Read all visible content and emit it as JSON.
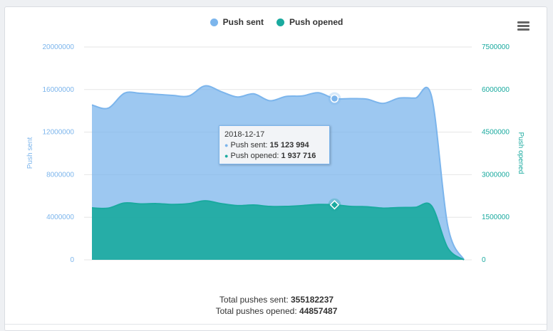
{
  "legend": {
    "items": [
      {
        "label": "Push sent",
        "color": "#7cb5ec"
      },
      {
        "label": "Push opened",
        "color": "#1aaa9f"
      }
    ]
  },
  "menu_icon": "hamburger-menu-icon",
  "axes": {
    "left": {
      "title": "Push sent",
      "ticks": [
        "20000000",
        "16000000",
        "12000000",
        "8000000",
        "4000000",
        "0"
      ],
      "color": "#7cb5ec"
    },
    "right": {
      "title": "Push opened",
      "ticks": [
        "7500000",
        "6000000",
        "4500000",
        "3000000",
        "1500000",
        "0"
      ],
      "color": "#1aaa9f"
    }
  },
  "tooltip": {
    "date": "2018-12-17",
    "rows": [
      {
        "label": "Push sent:",
        "value": "15 123 994"
      },
      {
        "label": "Push opened:",
        "value": "1 937 716"
      }
    ]
  },
  "totals": {
    "sent_label": "Total pushes sent:",
    "sent_value": "355182237",
    "opened_label": "Total pushes opened:",
    "opened_value": "44857487"
  },
  "chart_data": {
    "type": "area",
    "xlabel": "",
    "grid": true,
    "legend_position": "top-center",
    "series": [
      {
        "name": "Push sent",
        "axis": "left",
        "ylim": [
          0,
          20000000
        ],
        "color": "#7cb5ec",
        "values": [
          14550000,
          14250000,
          15650000,
          15650000,
          15550000,
          15450000,
          15400000,
          16350000,
          15800000,
          15300000,
          15600000,
          14950000,
          15350000,
          15400000,
          15700000,
          15150000,
          15150000,
          15100000,
          14700000,
          15200000,
          15200000,
          15350000,
          3200000,
          0
        ]
      },
      {
        "name": "Push opened",
        "axis": "right",
        "ylim": [
          0,
          7500000
        ],
        "color": "#1aaa9f",
        "values": [
          1830000,
          1820000,
          2000000,
          1970000,
          1980000,
          1950000,
          1980000,
          2080000,
          1980000,
          1910000,
          1930000,
          1880000,
          1880000,
          1910000,
          1950000,
          1937716,
          1880000,
          1870000,
          1820000,
          1840000,
          1850000,
          1900000,
          420000,
          0
        ]
      }
    ],
    "highlight_index": 15
  }
}
